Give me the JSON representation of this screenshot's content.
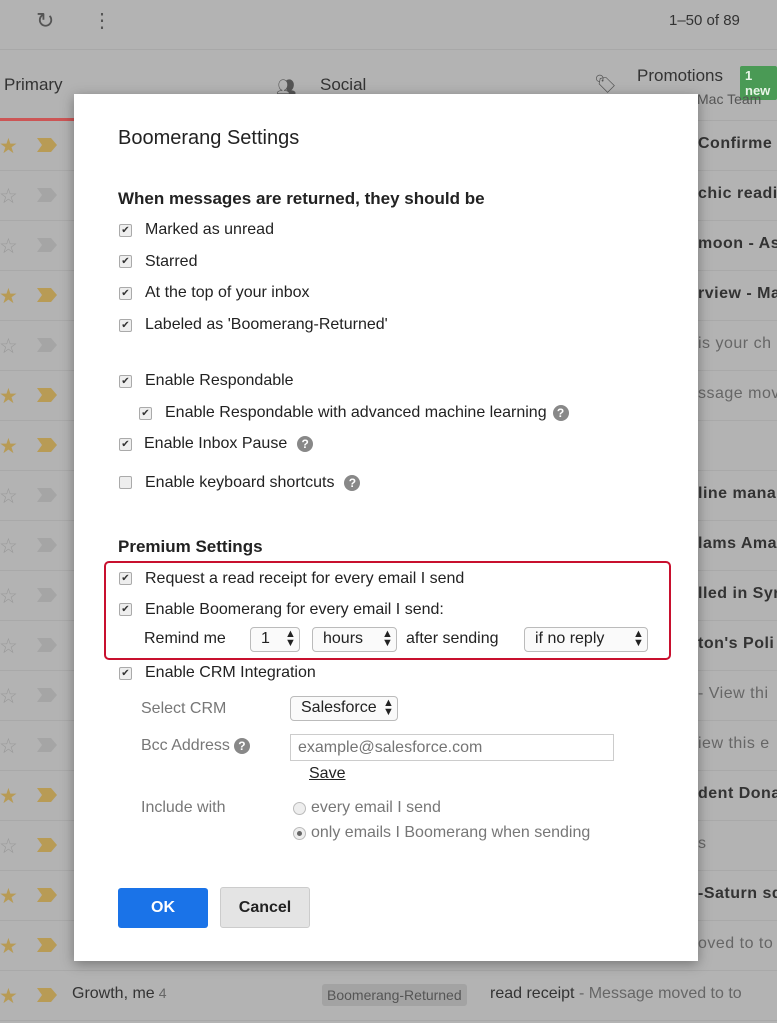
{
  "toolbar": {
    "pagination": "1–50 of 89"
  },
  "tabs": {
    "primary": "Primary",
    "social": "Social",
    "promotions": "Promotions",
    "promotions_badge": "1 new",
    "promotions_sub": "Mac Team"
  },
  "colors": {
    "accent": "#1a73e8",
    "highlight_border": "#c8102e",
    "star": "#b89b55"
  },
  "rows": [
    {
      "starred": true,
      "important": true,
      "text": "Confirme",
      "bold": true
    },
    {
      "starred": false,
      "important": false,
      "text": "chic readi",
      "bold": true
    },
    {
      "starred": false,
      "important": false,
      "text": "moon - As",
      "bold": true
    },
    {
      "starred": true,
      "important": true,
      "text": "rview - Ma",
      "bold": true
    },
    {
      "starred": false,
      "important": false,
      "text": "is your ch",
      "bold": false
    },
    {
      "starred": true,
      "important": true,
      "text": "ssage mov",
      "bold": false
    },
    {
      "starred": true,
      "important": true,
      "text": "",
      "bold": false
    },
    {
      "starred": false,
      "important": false,
      "text": "line mana",
      "bold": true
    },
    {
      "starred": false,
      "important": false,
      "text": "lams Ama",
      "bold": true
    },
    {
      "starred": false,
      "important": false,
      "text": "lled in Syr",
      "bold": true
    },
    {
      "starred": false,
      "important": false,
      "text": "ton's Poli",
      "bold": true
    },
    {
      "starred": false,
      "important": false,
      "text": "- View thi",
      "bold": false
    },
    {
      "starred": false,
      "important": false,
      "text": "iew this e",
      "bold": false
    },
    {
      "starred": true,
      "important": true,
      "text": "dent Dona",
      "bold": true
    },
    {
      "starred": false,
      "important": true,
      "text": "s",
      "bold": false
    },
    {
      "starred": true,
      "important": true,
      "text": "-Saturn sq",
      "bold": true
    },
    {
      "starred": true,
      "important": true,
      "text": "oved to to",
      "bold": false
    }
  ],
  "last_row": {
    "sender": "Growth, me",
    "count": "4",
    "label": "Boomerang-Returned",
    "subject": "read receipt",
    "snippet": " - Message moved to to"
  },
  "dialog": {
    "title": "Boomerang Settings",
    "returned_heading": "When messages are returned, they should be",
    "opt_unread": "Marked as unread",
    "opt_starred": "Starred",
    "opt_top": "At the top of your inbox",
    "opt_labeled": "Labeled as 'Boomerang-Returned'",
    "opt_respondable": "Enable Respondable",
    "opt_respondable_ml": "Enable Respondable with advanced machine learning",
    "opt_pause": "Enable Inbox Pause",
    "opt_shortcuts": "Enable keyboard shortcuts",
    "help": "?",
    "premium_heading": "Premium Settings",
    "opt_read_receipt": "Request a read receipt for every email I send",
    "opt_boomerang_all": "Enable Boomerang for every email I send:",
    "remind_me": "Remind me",
    "remind_value": "1",
    "remind_unit": "hours",
    "after_sending": "after sending",
    "condition": "if no reply",
    "opt_crm": "Enable CRM Integration",
    "select_crm_label": "Select CRM",
    "select_crm_value": "Salesforce",
    "bcc_label": "Bcc Address",
    "bcc_placeholder": "example@salesforce.com",
    "save": "Save",
    "include_label": "Include with",
    "include_every": "every email I send",
    "include_only": "only emails I Boomerang when sending",
    "ok": "OK",
    "cancel": "Cancel"
  }
}
